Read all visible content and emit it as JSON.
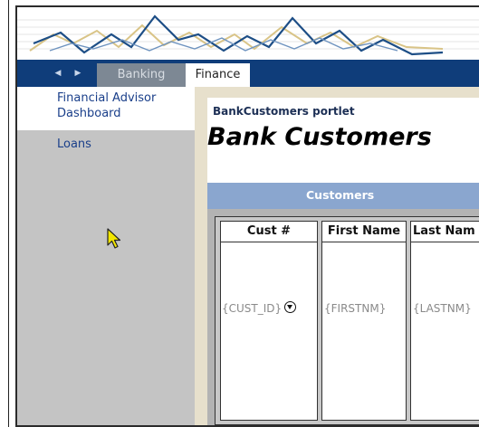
{
  "tabs": {
    "banking_label": "Banking",
    "finance_label": "Finance"
  },
  "sidebar": {
    "items": [
      {
        "label_line1": "Financial Advisor",
        "label_line2": "Dashboard"
      },
      {
        "label": "Loans"
      }
    ]
  },
  "portlet": {
    "title": "BankCustomers portlet",
    "heading": "Bank Customers",
    "table": {
      "caption": "Customers",
      "columns": [
        {
          "header": "Cust #",
          "value": "{CUST_ID}"
        },
        {
          "header": "First Name",
          "value": "{FIRSTNM}"
        },
        {
          "header": "Last Nam",
          "value": "{LASTNM}"
        }
      ]
    }
  },
  "colors": {
    "tab_bar": "#0f3d7a",
    "sidebar": "#c4c4c4",
    "portlet_bg": "#e7e0cc",
    "customers_bar": "#8aa6cf",
    "link": "#1a3f8a"
  },
  "icons": [
    "back-arrow-icon",
    "forward-arrow-icon",
    "sort-down-icon",
    "mouse-pointer-icon"
  ]
}
